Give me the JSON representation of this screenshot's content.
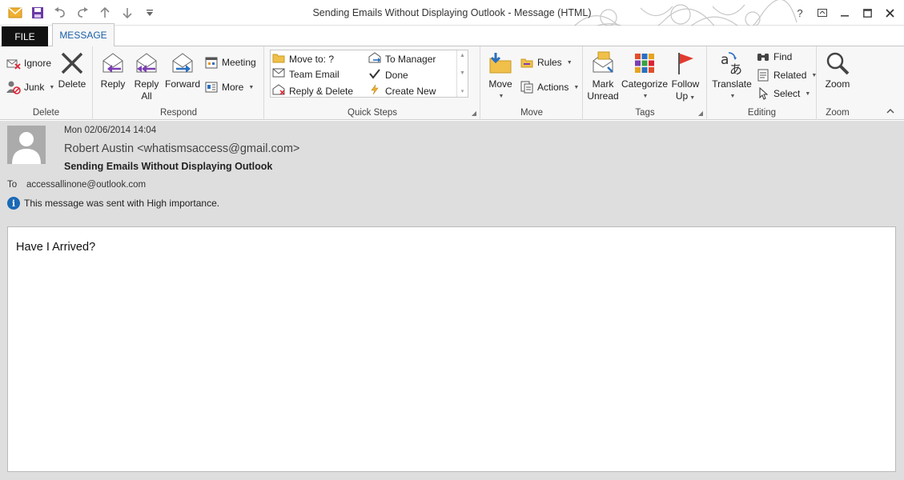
{
  "window": {
    "title": "Sending Emails Without Displaying Outlook - Message (HTML)",
    "controls": [
      "?",
      "restore",
      "minimize",
      "maximize",
      "close"
    ]
  },
  "quick_access": [
    "mail-icon",
    "save-icon",
    "undo-icon",
    "redo-icon",
    "up-arrow-icon",
    "down-arrow-icon",
    "customize-icon"
  ],
  "tabs": {
    "file": "FILE",
    "message": "MESSAGE"
  },
  "ribbon": {
    "delete_group": {
      "label": "Delete",
      "ignore": "Ignore",
      "junk": "Junk",
      "delete": "Delete"
    },
    "respond_group": {
      "label": "Respond",
      "reply": "Reply",
      "reply_all_line1": "Reply",
      "reply_all_line2": "All",
      "forward": "Forward",
      "meeting": "Meeting",
      "more": "More"
    },
    "quicksteps_group": {
      "label": "Quick Steps",
      "items": [
        "Move to: ?",
        "Team Email",
        "Reply & Delete",
        "To Manager",
        "Done",
        "Create New"
      ]
    },
    "move_group": {
      "label": "Move",
      "move": "Move",
      "rules": "Rules",
      "actions": "Actions"
    },
    "tags_group": {
      "label": "Tags",
      "mark_unread_line1": "Mark",
      "mark_unread_line2": "Unread",
      "categorize": "Categorize",
      "follow_up_line1": "Follow",
      "follow_up_line2": "Up"
    },
    "editing_group": {
      "label": "Editing",
      "translate": "Translate",
      "find": "Find",
      "related": "Related",
      "select": "Select"
    },
    "zoom_group": {
      "label": "Zoom",
      "zoom": "Zoom"
    }
  },
  "message": {
    "date": "Mon 02/06/2014 14:04",
    "sender": "Robert Austin <whatismsaccess@gmail.com>",
    "subject": "Sending Emails Without Displaying Outlook",
    "to_label": "To",
    "to_address": "accessallinone@outlook.com",
    "importance_note": "This message was sent with High importance.",
    "body_text": "Have I Arrived?"
  },
  "colors": {
    "file_tab_bg": "#111111",
    "accent_blue": "#1a5ea8",
    "reply_purple": "#7b3fb3",
    "forward_blue": "#2a6fc2",
    "flag_red": "#e03b2f",
    "header_bg": "#dedede"
  }
}
